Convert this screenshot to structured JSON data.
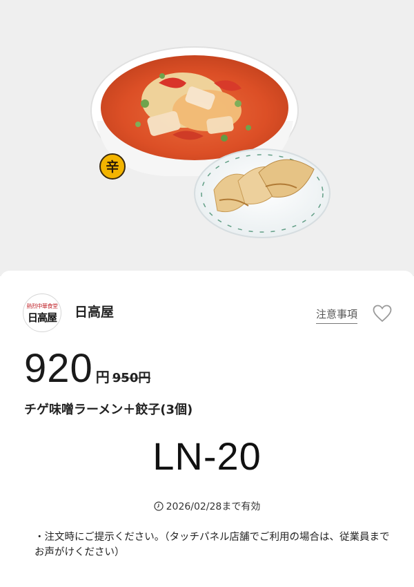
{
  "hero": {
    "spicy_badge": "辛"
  },
  "shop": {
    "logo_top": "熱烈中華食堂",
    "logo_main": "日高屋",
    "name": "日高屋"
  },
  "actions": {
    "notice_label": "注意事項",
    "favorite_icon": "heart-outline-icon"
  },
  "coupon": {
    "price": "920",
    "price_unit": "円",
    "original_price": "950円",
    "item_name": "チゲ味噌ラーメン＋餃子(3個)",
    "code": "LN-20",
    "validity": "2026/02/28まで有効",
    "note_bullet": "・",
    "note": "注文時にご提示ください。（タッチパネル店舗でご利用の場合は、従業員までお声がけください）"
  },
  "colors": {
    "hero_background": "#efefef",
    "broth": "#e2542a",
    "logo_accent": "#c1272d",
    "badge_yellow": "#f3b400"
  }
}
